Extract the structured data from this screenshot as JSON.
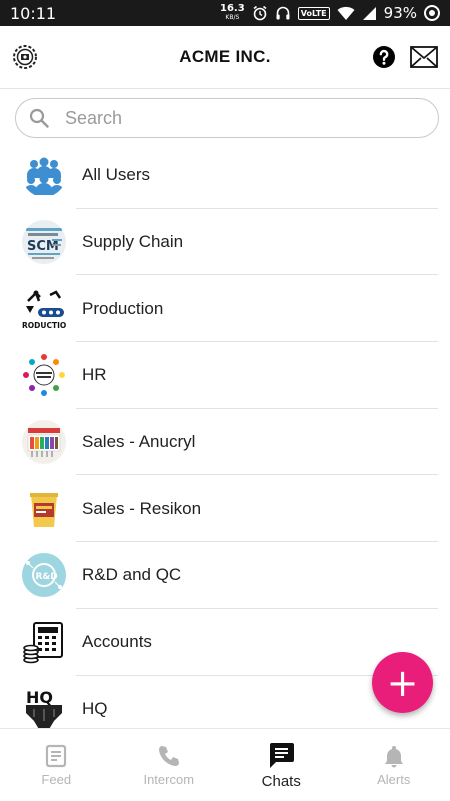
{
  "status_bar": {
    "time": "10:11",
    "net_speed": "16.3",
    "net_unit": "KB/S",
    "volte": "VoLTE",
    "battery": "93%"
  },
  "header": {
    "title": "ACME INC.",
    "icons": [
      "settings-badge-icon",
      "help-icon",
      "mail-icon"
    ]
  },
  "search": {
    "placeholder": "Search",
    "value": ""
  },
  "groups": [
    {
      "label": "All Users",
      "icon": "users-group-icon"
    },
    {
      "label": "Supply Chain",
      "icon": "scm-word-cloud-icon"
    },
    {
      "label": "Production",
      "icon": "production-line-icon"
    },
    {
      "label": "HR",
      "icon": "human-resources-icon"
    },
    {
      "label": "Sales - Anucryl",
      "icon": "paint-swatches-icon"
    },
    {
      "label": "Sales - Resikon",
      "icon": "paint-bucket-icon"
    },
    {
      "label": "R&D and QC",
      "icon": "rnd-icon"
    },
    {
      "label": "Accounts",
      "icon": "calculator-coins-icon"
    },
    {
      "label": "HQ",
      "icon": "hq-building-icon"
    }
  ],
  "fab": {
    "label": "+"
  },
  "bottom_nav": [
    {
      "label": "Feed",
      "icon": "feed-icon",
      "active": false
    },
    {
      "label": "Intercom",
      "icon": "phone-icon",
      "active": false
    },
    {
      "label": "Chats",
      "icon": "chat-icon",
      "active": true
    },
    {
      "label": "Alerts",
      "icon": "bell-icon",
      "active": false
    }
  ],
  "colors": {
    "accent": "#e91e7a",
    "status_bar": "#1a1a1a",
    "inactive_tab": "#b5b5b5"
  }
}
